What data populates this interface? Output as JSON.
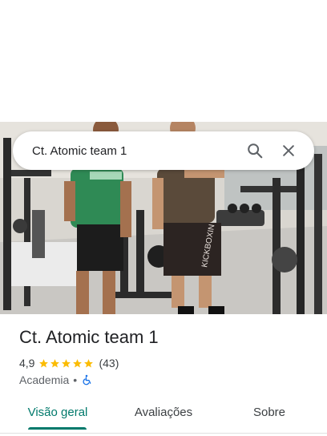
{
  "search": {
    "query": "Ct. Atomic team 1"
  },
  "icons": {
    "search": "search-icon",
    "close": "close-icon",
    "wheelchair": "wheelchair-accessible-icon",
    "star": "star-icon"
  },
  "place": {
    "name": "Ct. Atomic team 1",
    "rating": "4,9",
    "stars": 5,
    "review_count": "(43)",
    "category": "Academia",
    "separator": "•"
  },
  "tabs": [
    {
      "label": "Visão geral",
      "active": true
    },
    {
      "label": "Avaliações",
      "active": false
    },
    {
      "label": "Sobre",
      "active": false
    }
  ],
  "photo": {
    "shirt_text_left": "",
    "shorts_text": "KICKBOXIN"
  },
  "colors": {
    "accent": "#00796b",
    "star": "#fbbc04",
    "access_icon": "#1a73e8"
  }
}
